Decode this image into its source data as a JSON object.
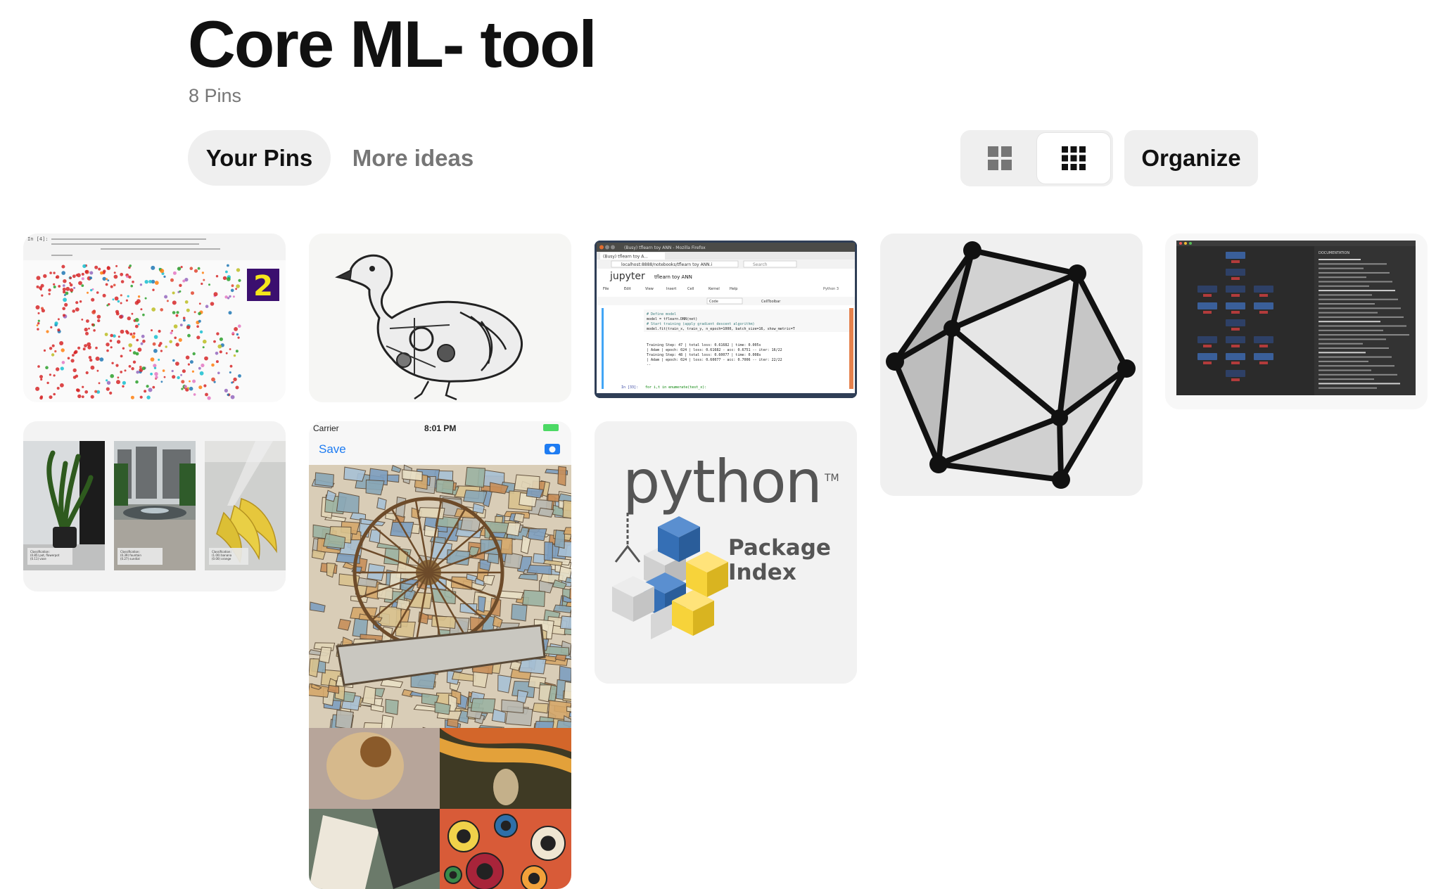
{
  "board": {
    "title": "Core ML- tool",
    "pin_count": "8 Pins"
  },
  "tabs": {
    "your_pins": "Your Pins",
    "more_ideas": "More ideas"
  },
  "view": {
    "default_icon": "grid-2x2-icon",
    "compact_icon": "grid-3x3-icon",
    "selected": "compact"
  },
  "actions": {
    "organize": "Organize"
  },
  "pins": {
    "p1": {
      "code": "In [4]:",
      "digit": "2"
    },
    "p3": {
      "window_title": "(Busy) tflearn toy ANN - Mozilla Firefox",
      "tab": "(Busy) tflearn toy A...",
      "url": "localhost:8888/notebooks/tflearn toy ANN.i",
      "search": "Search",
      "brand": "jupyter",
      "notebook": "tflearn toy ANN",
      "kernel": "Python 3",
      "menu": [
        "File",
        "Edit",
        "View",
        "Insert",
        "Cell",
        "Kernel",
        "Help"
      ],
      "cell_type": "Code",
      "celltoolbar": "CellToolbar",
      "lines": [
        "# Define model",
        "model = tflearn.DNN(net)",
        "# Start training (apply gradient descent algorithm)",
        "model.fit(train_x, train_y, n_epoch=1000, batch_size=16, show_metric=T"
      ],
      "output": [
        "Training Step: 47  | total loss: 0.61682 | time: 0.005s",
        "| Adam | epoch: 024 | loss: 0.61682 - acc: 0.6751 -- iter: 16/22",
        "Training Step: 48  | total loss: 0.60077 | time: 0.008s",
        "| Adam | epoch: 024 | loss: 0.60077 - acc: 0.7006 -- iter: 22/22",
        "--"
      ],
      "prompt": "In [33]:",
      "next_line": "for i,t in enumerate(test_x):"
    },
    "p5": {
      "panel_title": "DOCUMENTATION"
    },
    "p6": {
      "labels": [
        "Classification: (0.85) pot, flowerpot (0.11) vase",
        "Classification: (0.39) fountain (0.27) sundial",
        "Classification: (1.00) banana (0.00) orange"
      ]
    },
    "p7": {
      "carrier": "Carrier",
      "time": "8:01 PM",
      "save": "Save"
    },
    "p8": {
      "word": "python",
      "tm": "TM",
      "line1": "Package",
      "line2": "Index"
    }
  }
}
